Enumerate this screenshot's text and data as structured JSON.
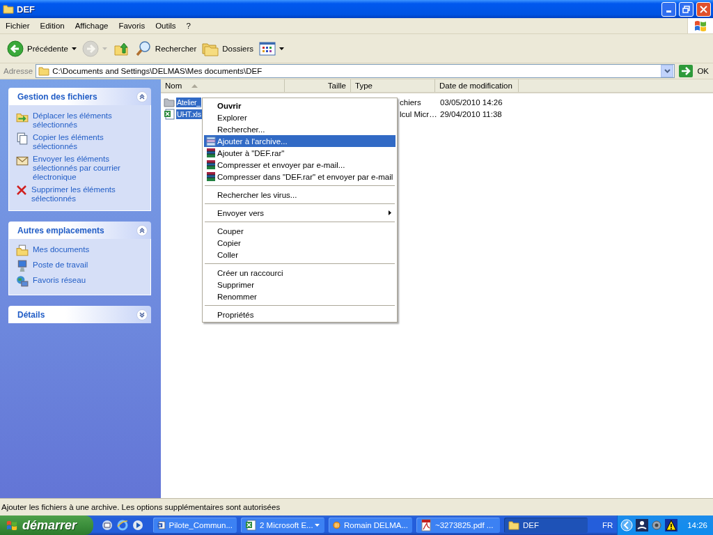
{
  "window": {
    "title": "DEF"
  },
  "menu_bar": [
    "Fichier",
    "Edition",
    "Affichage",
    "Favoris",
    "Outils",
    "?"
  ],
  "toolbar": [
    {
      "kind": "back",
      "label": "Précédente",
      "dropdown": true,
      "disabled": false
    },
    {
      "kind": "forward",
      "dropdown": true,
      "disabled": true
    },
    {
      "kind": "up",
      "disabled": false
    },
    {
      "kind": "search",
      "label": "Rechercher",
      "disabled": false
    },
    {
      "kind": "folders",
      "label": "Dossiers",
      "disabled": false
    },
    {
      "kind": "views",
      "dropdown": true,
      "disabled": false
    }
  ],
  "address_bar": {
    "label": "Adresse",
    "value": "C:\\Documents and Settings\\DELMAS\\Mes documents\\DEF",
    "go_label": "OK"
  },
  "task_panes": [
    {
      "title": "Gestion des fichiers",
      "expanded": true,
      "items": [
        {
          "kind": "move",
          "label": "Déplacer les éléments sélectionnés"
        },
        {
          "kind": "copy",
          "label": "Copier les éléments sélectionnés"
        },
        {
          "kind": "mail",
          "label": "Envoyer les éléments sélectionnés par courrier électronique"
        },
        {
          "kind": "delete",
          "label": "Supprimer les éléments sélectionnés"
        }
      ]
    },
    {
      "title": "Autres emplacements",
      "expanded": true,
      "items": [
        {
          "kind": "documents",
          "label": "Mes documents"
        },
        {
          "kind": "computer",
          "label": "Poste de travail"
        },
        {
          "kind": "network",
          "label": "Favoris réseau"
        }
      ]
    },
    {
      "title": "Détails",
      "expanded": false
    }
  ],
  "file_list": {
    "columns": [
      {
        "label": "Nom",
        "sorted": true
      },
      {
        "label": "Taille",
        "sorted": false
      },
      {
        "label": "Type",
        "sorted": false
      },
      {
        "label": "Date de modification",
        "sorted": false
      }
    ],
    "rows": [
      {
        "kind": "folder",
        "name": "Atelier_",
        "type": "chiers",
        "modified": "03/05/2010 14:26",
        "selected": true
      },
      {
        "kind": "excel",
        "name": "UHT.xls",
        "type": "lcul Micr…",
        "modified": "29/04/2010 11:38",
        "selected": true
      }
    ]
  },
  "context_menu": [
    [
      {
        "label": "Ouvrir",
        "default": true,
        "selected": false
      },
      {
        "label": "Explorer",
        "default": false,
        "selected": false
      },
      {
        "label": "Rechercher...",
        "default": false,
        "selected": false
      },
      {
        "label": "Ajouter à l'archive...",
        "kind": "archive",
        "default": false,
        "selected": true
      },
      {
        "label": "Ajouter à \"DEF.rar\"",
        "kind": "rar",
        "default": false,
        "selected": false
      },
      {
        "label": "Compresser et envoyer par e-mail...",
        "kind": "rar",
        "default": false,
        "selected": false
      },
      {
        "label": "Compresser dans \"DEF.rar\" et envoyer par e-mail",
        "kind": "rar",
        "default": false,
        "selected": false
      }
    ],
    [
      {
        "label": "Rechercher les virus...",
        "default": false,
        "selected": false
      }
    ],
    [
      {
        "label": "Envoyer vers",
        "submenu": true,
        "default": false,
        "selected": false
      }
    ],
    [
      {
        "label": "Couper",
        "default": false,
        "selected": false
      },
      {
        "label": "Copier",
        "default": false,
        "selected": false
      },
      {
        "label": "Coller",
        "default": false,
        "selected": false
      }
    ],
    [
      {
        "label": "Créer un raccourci",
        "default": false,
        "selected": false
      },
      {
        "label": "Supprimer",
        "default": false,
        "selected": false
      },
      {
        "label": "Renommer",
        "default": false,
        "selected": false
      }
    ],
    [
      {
        "label": "Propriétés",
        "default": false,
        "selected": false
      }
    ]
  ],
  "status_bar": "Ajouter les fichiers à une archive. Les options supplémentaires sont autorisées",
  "taskbar": {
    "start_label": "démarrer",
    "tasks": [
      {
        "kind": "word",
        "label": "Pilote_Commun...",
        "selected": false
      },
      {
        "kind": "excel",
        "label": "2 Microsoft E...",
        "dropdown": true,
        "selected": false
      },
      {
        "kind": "messenger",
        "label": "Romain DELMA...",
        "selected": false
      },
      {
        "kind": "pdf",
        "label": "~3273825.pdf ...",
        "selected": false
      },
      {
        "kind": "folder",
        "label": "DEF",
        "selected": true
      }
    ],
    "language": "FR",
    "clock": "14:26"
  }
}
